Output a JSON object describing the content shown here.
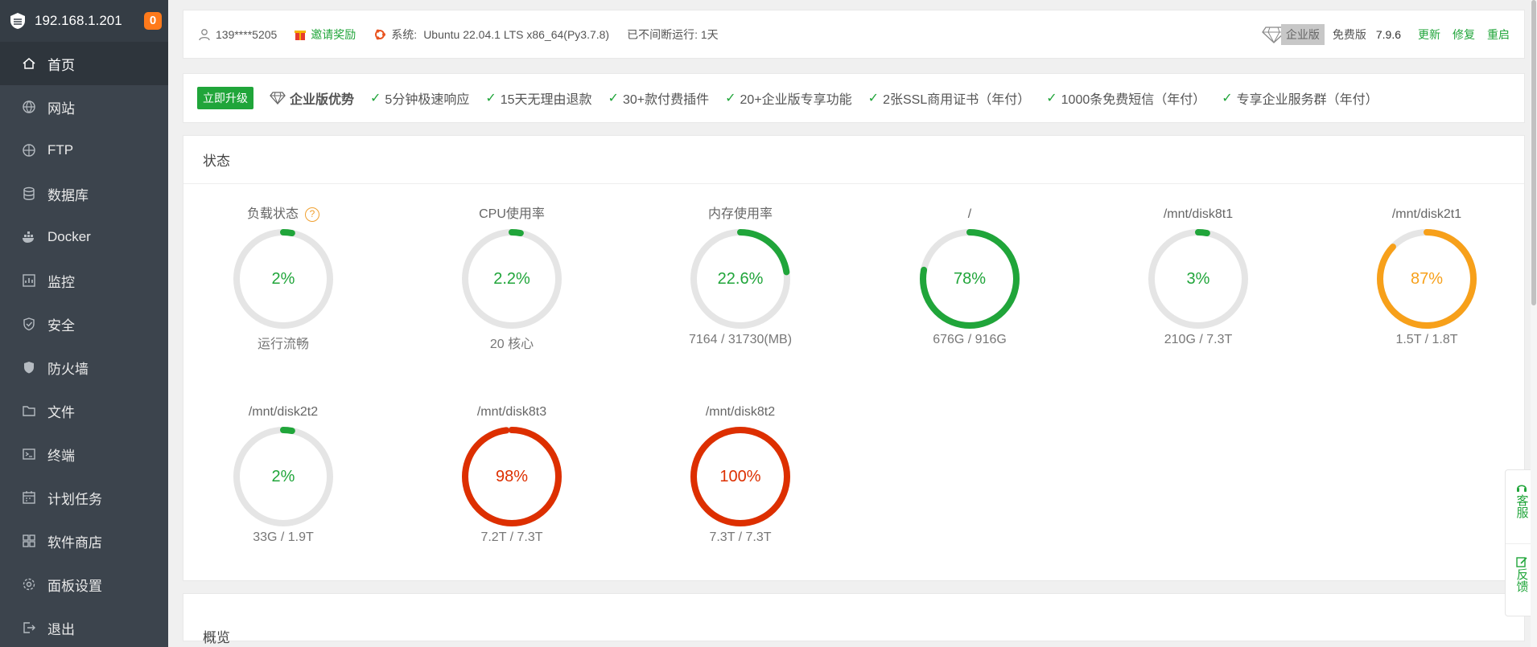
{
  "sidebar": {
    "ip": "192.168.1.201",
    "badge": "0",
    "items": [
      {
        "label": "首页",
        "icon": "home-icon"
      },
      {
        "label": "网站",
        "icon": "globe-icon"
      },
      {
        "label": "FTP",
        "icon": "ftp-icon"
      },
      {
        "label": "数据库",
        "icon": "database-icon"
      },
      {
        "label": "Docker",
        "icon": "docker-icon"
      },
      {
        "label": "监控",
        "icon": "monitor-icon"
      },
      {
        "label": "安全",
        "icon": "shield-icon"
      },
      {
        "label": "防火墙",
        "icon": "firewall-icon"
      },
      {
        "label": "文件",
        "icon": "folder-icon"
      },
      {
        "label": "终端",
        "icon": "terminal-icon"
      },
      {
        "label": "计划任务",
        "icon": "calendar-icon"
      },
      {
        "label": "软件商店",
        "icon": "apps-icon"
      },
      {
        "label": "面板设置",
        "icon": "gear-icon"
      },
      {
        "label": "退出",
        "icon": "logout-icon"
      }
    ]
  },
  "topbar": {
    "user": "139****5205",
    "invite": "邀请奖励",
    "system_label": "系统:",
    "system_value": "Ubuntu 22.04.1 LTS x86_64(Py3.7.8)",
    "uptime": "已不间断运行: 1天",
    "enterprise": "企业版",
    "free_label": "免费版",
    "version": "7.9.6",
    "update": "更新",
    "repair": "修复",
    "restart": "重启"
  },
  "promo": {
    "upgrade": "立即升级",
    "advantage": "企业版优势",
    "items": [
      "5分钟极速响应",
      "15天无理由退款",
      "30+款付费插件",
      "20+企业版专享功能",
      "2张SSL商用证书（年付）",
      "1000条免费短信（年付）",
      "专享企业服务群（年付）"
    ]
  },
  "status": {
    "title": "状态",
    "gauges": [
      {
        "title": "负载状态",
        "percent": 2,
        "text": "2%",
        "bottom": "运行流畅",
        "color": "#20a53a",
        "help": "?"
      },
      {
        "title": "CPU使用率",
        "percent": 2.2,
        "text": "2.2%",
        "bottom": "20 核心",
        "color": "#20a53a"
      },
      {
        "title": "内存使用率",
        "percent": 22.6,
        "text": "22.6%",
        "bottom": "7164 / 31730(MB)",
        "color": "#20a53a"
      },
      {
        "title": "/",
        "percent": 78,
        "text": "78%",
        "bottom": "676G / 916G",
        "color": "#20a53a"
      },
      {
        "title": "/mnt/disk8t1",
        "percent": 3,
        "text": "3%",
        "bottom": "210G / 7.3T",
        "color": "#20a53a"
      },
      {
        "title": "/mnt/disk2t1",
        "percent": 87,
        "text": "87%",
        "bottom": "1.5T / 1.8T",
        "color": "#f7a01a"
      },
      {
        "title": "/mnt/disk2t2",
        "percent": 2,
        "text": "2%",
        "bottom": "33G / 1.9T",
        "color": "#20a53a"
      },
      {
        "title": "/mnt/disk8t3",
        "percent": 98,
        "text": "98%",
        "bottom": "7.2T / 7.3T",
        "color": "#dd2f00"
      },
      {
        "title": "/mnt/disk8t2",
        "percent": 100,
        "text": "100%",
        "bottom": "7.3T / 7.3T",
        "color": "#dd2f00"
      }
    ]
  },
  "overview": {
    "title": "概览"
  },
  "float": {
    "service": "客服",
    "feedback": "反馈"
  }
}
